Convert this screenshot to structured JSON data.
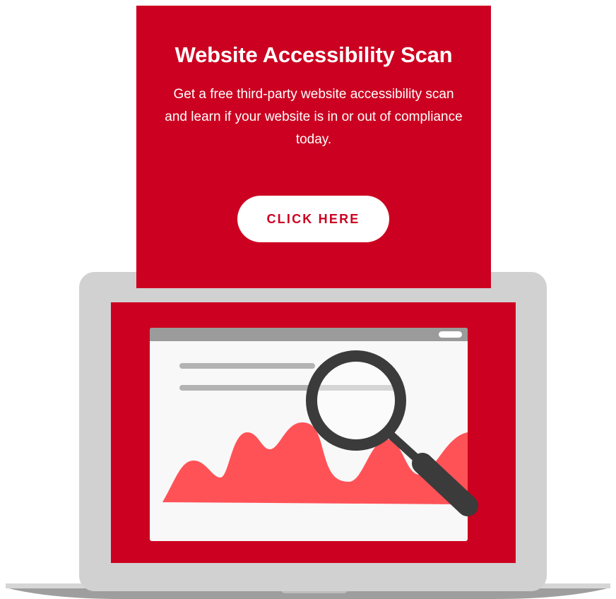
{
  "promo": {
    "title": "Website Accessibility Scan",
    "description": "Get a free third-party website accessibility scan and learn if your website is in or out of compliance today.",
    "cta_label": "CLICK HERE"
  },
  "colors": {
    "brand_red": "#cc0020",
    "chart_red": "#ff5257",
    "laptop_gray": "#d1d1d1",
    "magnifier_dark": "#3b3b3b"
  },
  "illustration": {
    "device": "laptop-icon",
    "tool": "magnifying-glass-icon",
    "content": "area-chart-icon"
  }
}
